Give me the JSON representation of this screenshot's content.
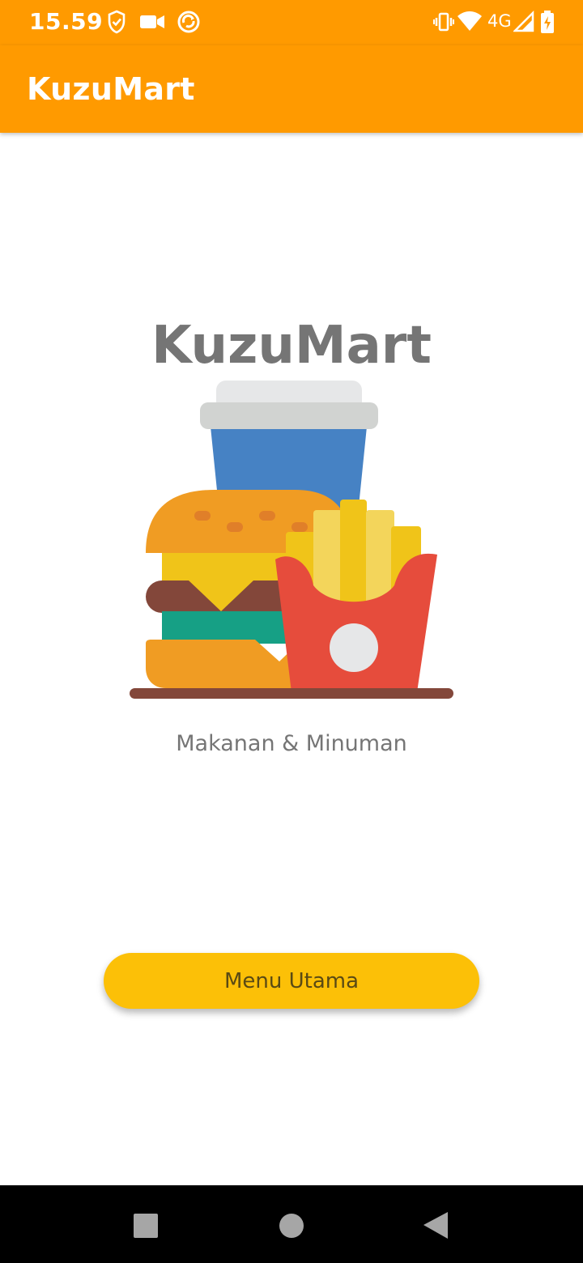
{
  "status_bar": {
    "time": "15.59",
    "network_label": "4G",
    "left_icons": [
      "shield-check-icon",
      "video-camera-icon",
      "sync-circle-icon"
    ],
    "right_icons": [
      "vibrate-icon",
      "wifi-icon",
      "signal-icon",
      "battery-charging-icon"
    ]
  },
  "app_bar": {
    "title": "KuzuMart"
  },
  "main": {
    "headline": "KuzuMart",
    "illustration": "burger-fries-drink-illustration",
    "subtitle": "Makanan & Minuman",
    "button_label": "Menu Utama"
  },
  "nav_bar": {
    "icons": [
      "recents-square-icon",
      "home-circle-icon",
      "back-triangle-icon"
    ]
  },
  "colors": {
    "primary": "#ff9a00",
    "button": "#fcc007",
    "text_gray": "#757575"
  }
}
